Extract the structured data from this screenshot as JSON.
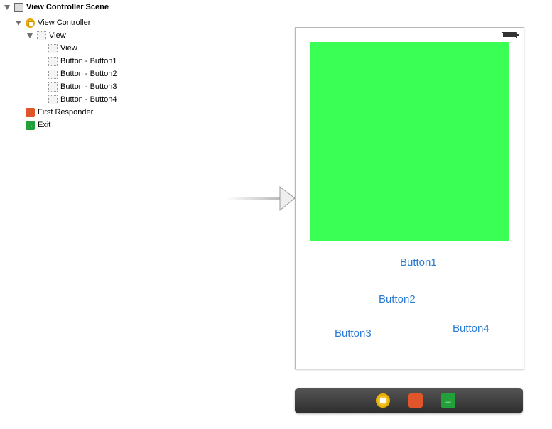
{
  "outline": {
    "scene": "View Controller Scene",
    "view_controller": "View Controller",
    "view": "View",
    "children": [
      "View",
      "Button - Button1",
      "Button - Button2",
      "Button - Button3",
      "Button - Button4"
    ],
    "first_responder": "First Responder",
    "exit": "Exit"
  },
  "canvas": {
    "green_color": "#3aff55",
    "buttons": [
      "Button1",
      "Button2",
      "Button3",
      "Button4"
    ],
    "button_color": "#2a7bd4"
  },
  "dock": {
    "icons": [
      "view-controller-icon",
      "first-responder-icon",
      "exit-icon"
    ]
  }
}
